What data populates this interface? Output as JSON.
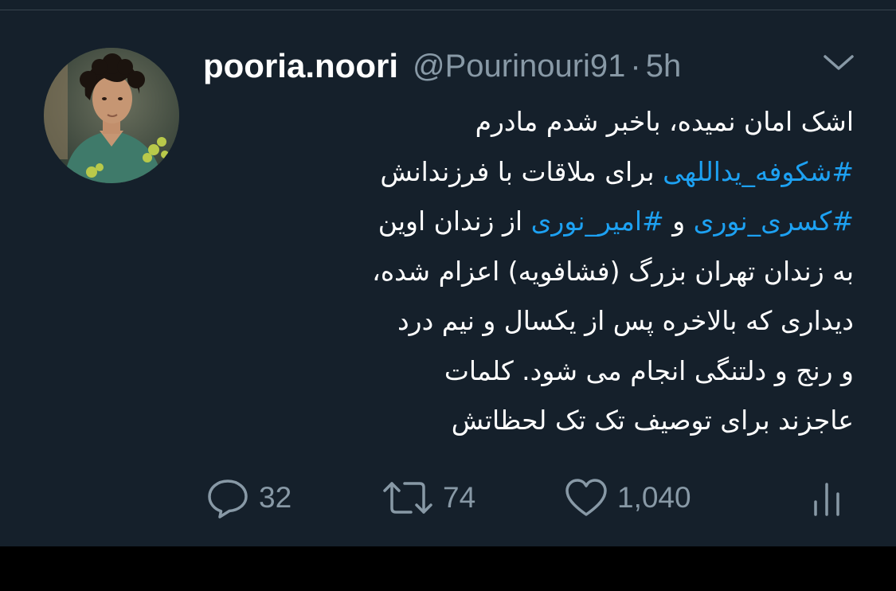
{
  "tweet": {
    "display_name": "pooria.noori",
    "handle": "@Pourinouri91",
    "separator": "·",
    "time": "5h",
    "lines": [
      [
        {
          "text": "اشک امان نمیده، باخبر شدم مادرم",
          "hashtag": false
        }
      ],
      [
        {
          "text": "#شکوفه_یداللهی",
          "hashtag": true
        },
        {
          "text": " برای ملاقات با فرزندانش",
          "hashtag": false
        }
      ],
      [
        {
          "text": "#کسری_نوری",
          "hashtag": true
        },
        {
          "text": " و ",
          "hashtag": false
        },
        {
          "text": "#امیر_نوری",
          "hashtag": true
        },
        {
          "text": " از زندان اوین",
          "hashtag": false
        }
      ],
      [
        {
          "text": "به زندان تهران بزرگ (فشافویه) اعزام شده،",
          "hashtag": false
        }
      ],
      [
        {
          "text": "دیداری که بالاخره پس از یکسال و نیم درد",
          "hashtag": false
        }
      ],
      [
        {
          "text": "و رنج و دلتنگی انجام می شود. کلمات",
          "hashtag": false
        }
      ],
      [
        {
          "text": "عاجزند برای توصیف تک تک لحظاتش",
          "hashtag": false
        }
      ]
    ],
    "actions": {
      "reply": {
        "icon": "reply-icon",
        "count": "32"
      },
      "retweet": {
        "icon": "retweet-icon",
        "count": "74"
      },
      "like": {
        "icon": "heart-icon",
        "count": "1,040"
      },
      "stats": {
        "icon": "analytics-icon"
      }
    }
  },
  "colors": {
    "background": "#15202b",
    "text": "#ffffff",
    "secondary": "#8899a6",
    "hashtag": "#1da1f2"
  }
}
